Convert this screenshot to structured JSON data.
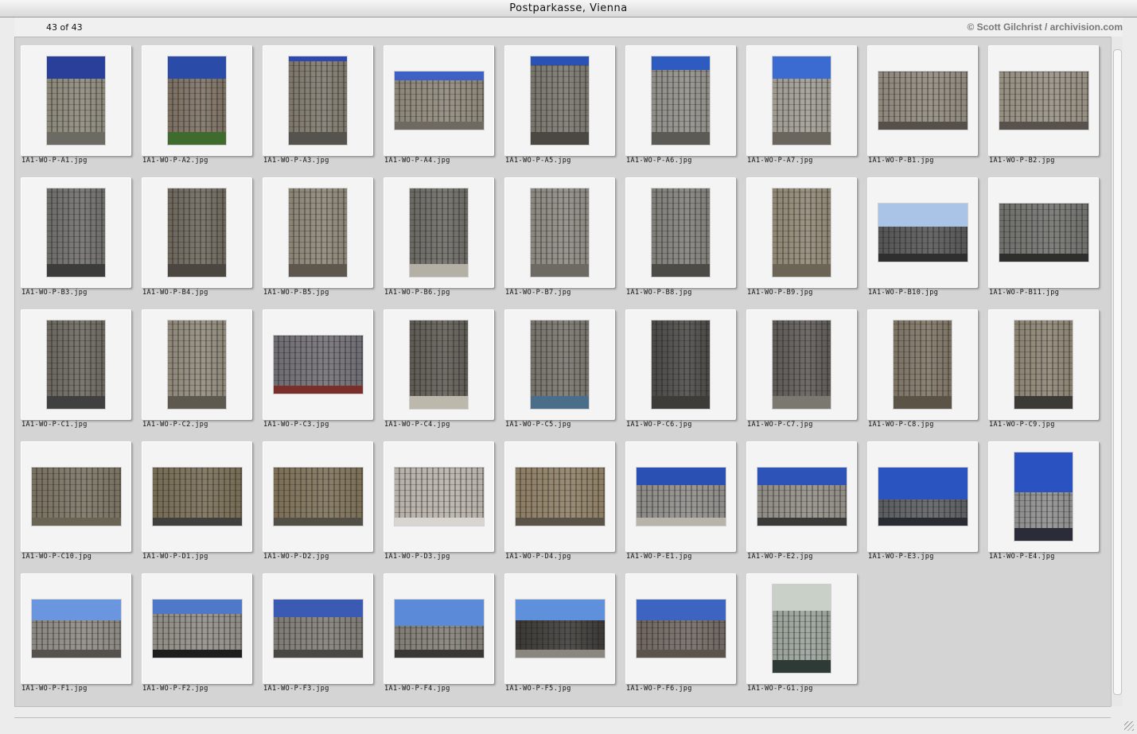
{
  "window": {
    "title": "Postparkasse, Vienna"
  },
  "info": {
    "count": "43 of 43",
    "copyright": "© Scott Gilchrist / archivision.com"
  },
  "thumbnails": [
    {
      "file": "1A1-WO-P-A1.jpg",
      "orient": "portrait",
      "sky": "#2a3f9a",
      "bldg": "#8a8678",
      "ground": "#6b6b63",
      "sky_frac": 0.25
    },
    {
      "file": "1A1-WO-P-A2.jpg",
      "orient": "portrait",
      "sky": "#2b4ba8",
      "bldg": "#7a6e60",
      "ground": "#3f6b2e",
      "sky_frac": 0.25
    },
    {
      "file": "1A1-WO-P-A3.jpg",
      "orient": "portrait",
      "sky": "#2d48b0",
      "bldg": "#7c766a",
      "ground": "#55534e",
      "sky_frac": 0.05
    },
    {
      "file": "1A1-WO-P-A4.jpg",
      "orient": "landscape",
      "sky": "#3f60c4",
      "bldg": "#8b8577",
      "ground": "#6e6a62",
      "sky_frac": 0.15
    },
    {
      "file": "1A1-WO-P-A5.jpg",
      "orient": "portrait",
      "sky": "#2a52b4",
      "bldg": "#77746c",
      "ground": "#4a4842",
      "sky_frac": 0.1
    },
    {
      "file": "1A1-WO-P-A6.jpg",
      "orient": "portrait",
      "sky": "#2d5bc0",
      "bldg": "#8e8c86",
      "ground": "#5c5a54",
      "sky_frac": 0.15
    },
    {
      "file": "1A1-WO-P-A7.jpg",
      "orient": "portrait",
      "sky": "#3b6ad0",
      "bldg": "#9e9a90",
      "ground": "#6a665e",
      "sky_frac": 0.25
    },
    {
      "file": "1A1-WO-P-B1.jpg",
      "orient": "landscape",
      "sky": "#b8b2a4",
      "bldg": "#8d867a",
      "ground": "#555049",
      "sky_frac": 0.0
    },
    {
      "file": "1A1-WO-P-B2.jpg",
      "orient": "landscape",
      "sky": "#c2bcae",
      "bldg": "#948d80",
      "ground": "#57524b",
      "sky_frac": 0.0
    },
    {
      "file": "1A1-WO-P-B3.jpg",
      "orient": "portrait",
      "sky": "#3d4f8f",
      "bldg": "#6c6b68",
      "ground": "#3c3c3a",
      "sky_frac": 0.0
    },
    {
      "file": "1A1-WO-P-B4.jpg",
      "orient": "portrait",
      "sky": "#aaa49a",
      "bldg": "#6b655a",
      "ground": "#4b4740",
      "sky_frac": 0.0
    },
    {
      "file": "1A1-WO-P-B5.jpg",
      "orient": "portrait",
      "sky": "#b9b2a4",
      "bldg": "#8a8374",
      "ground": "#5d574e",
      "sky_frac": 0.0
    },
    {
      "file": "1A1-WO-P-B6.jpg",
      "orient": "portrait",
      "sky": "#9e9c96",
      "bldg": "#6a6862",
      "ground": "#b4b0a6",
      "sky_frac": 0.0
    },
    {
      "file": "1A1-WO-P-B7.jpg",
      "orient": "portrait",
      "sky": "#54524c",
      "bldg": "#8a8780",
      "ground": "#6d6a64",
      "sky_frac": 0.0
    },
    {
      "file": "1A1-WO-P-B8.jpg",
      "orient": "portrait",
      "sky": "#c8cacc",
      "bldg": "#7f7d78",
      "ground": "#4d4b46",
      "sky_frac": 0.0
    },
    {
      "file": "1A1-WO-P-B9.jpg",
      "orient": "portrait",
      "sky": "#bbb39f",
      "bldg": "#8d8572",
      "ground": "#6c6555",
      "sky_frac": 0.0
    },
    {
      "file": "1A1-WO-P-B10.jpg",
      "orient": "landscape",
      "sky": "#a9c4e6",
      "bldg": "#545454",
      "ground": "#2f2f2f",
      "sky_frac": 0.4
    },
    {
      "file": "1A1-WO-P-B11.jpg",
      "orient": "landscape",
      "sky": "#a0a09a",
      "bldg": "#6e6e6a",
      "ground": "#2e2e2c",
      "sky_frac": 0.0
    },
    {
      "file": "1A1-WO-P-C1.jpg",
      "orient": "portrait",
      "sky": "#8f8a80",
      "bldg": "#6a665d",
      "ground": "#404040",
      "sky_frac": 0.0
    },
    {
      "file": "1A1-WO-P-C2.jpg",
      "orient": "portrait",
      "sky": "#b2ab9c",
      "bldg": "#8e8778",
      "ground": "#5e594f",
      "sky_frac": 0.0
    },
    {
      "file": "1A1-WO-P-C3.jpg",
      "orient": "landscape",
      "sky": "#3b3a3e",
      "bldg": "#6e6c72",
      "ground": "#7a2f2a",
      "sky_frac": 0.0
    },
    {
      "file": "1A1-WO-P-C4.jpg",
      "orient": "portrait",
      "sky": "#9f9c92",
      "bldg": "#5d5a53",
      "ground": "#bdb8ac",
      "sky_frac": 0.0
    },
    {
      "file": "1A1-WO-P-C5.jpg",
      "orient": "portrait",
      "sky": "#8a897f",
      "bldg": "#74726a",
      "ground": "#4a6d8a",
      "sky_frac": 0.0
    },
    {
      "file": "1A1-WO-P-C6.jpg",
      "orient": "portrait",
      "sky": "#5e5c58",
      "bldg": "#4a4845",
      "ground": "#3e3c39",
      "sky_frac": 0.0
    },
    {
      "file": "1A1-WO-P-C7.jpg",
      "orient": "portrait",
      "sky": "#444240",
      "bldg": "#5c5955",
      "ground": "#7b7870",
      "sky_frac": 0.0
    },
    {
      "file": "1A1-WO-P-C8.jpg",
      "orient": "portrait",
      "sky": "#9a9080",
      "bldg": "#7c7262",
      "ground": "#5b5346",
      "sky_frac": 0.0
    },
    {
      "file": "1A1-WO-P-C9.jpg",
      "orient": "portrait",
      "sky": "#aaa090",
      "bldg": "#8a8170",
      "ground": "#3c3a36",
      "sky_frac": 0.0
    },
    {
      "file": "1A1-WO-P-C10.jpg",
      "orient": "landscape",
      "sky": "#8a8478",
      "bldg": "#77705f",
      "ground": "#6a6454",
      "sky_frac": 0.0
    },
    {
      "file": "1A1-WO-P-D1.jpg",
      "orient": "landscape",
      "sky": "#8d7d5a",
      "bldg": "#756a52",
      "ground": "#40403e",
      "sky_frac": 0.0
    },
    {
      "file": "1A1-WO-P-D2.jpg",
      "orient": "landscape",
      "sky": "#8f7e58",
      "bldg": "#7b6e55",
      "ground": "#525046",
      "sky_frac": 0.0
    },
    {
      "file": "1A1-WO-P-D3.jpg",
      "orient": "landscape",
      "sky": "#3a3532",
      "bldg": "#b6b0a8",
      "ground": "#d8d4cf",
      "sky_frac": 0.0
    },
    {
      "file": "1A1-WO-P-D4.jpg",
      "orient": "landscape",
      "sky": "#30302e",
      "bldg": "#8c7c62",
      "ground": "#5a5348",
      "sky_frac": 0.0
    },
    {
      "file": "1A1-WO-P-E1.jpg",
      "orient": "landscape",
      "sky": "#2a50b4",
      "bldg": "#8c8a86",
      "ground": "#b8b4aa",
      "sky_frac": 0.3
    },
    {
      "file": "1A1-WO-P-E2.jpg",
      "orient": "landscape",
      "sky": "#2d53b8",
      "bldg": "#8f8b84",
      "ground": "#3a3a38",
      "sky_frac": 0.3
    },
    {
      "file": "1A1-WO-P-E3.jpg",
      "orient": "landscape",
      "sky": "#2a55c0",
      "bldg": "#5a5c60",
      "ground": "#2a2c34",
      "sky_frac": 0.55
    },
    {
      "file": "1A1-WO-P-E4.jpg",
      "orient": "portrait",
      "sky": "#2a52c0",
      "bldg": "#8c8c8c",
      "ground": "#2a2c38",
      "sky_frac": 0.45
    },
    {
      "file": "1A1-WO-P-F1.jpg",
      "orient": "landscape",
      "sky": "#6a96e0",
      "bldg": "#8a8680",
      "ground": "#55524e",
      "sky_frac": 0.35
    },
    {
      "file": "1A1-WO-P-F2.jpg",
      "orient": "landscape",
      "sky": "#5078c8",
      "bldg": "#8e8a84",
      "ground": "#1e1e1e",
      "sky_frac": 0.25
    },
    {
      "file": "1A1-WO-P-F3.jpg",
      "orient": "landscape",
      "sky": "#3a5ab4",
      "bldg": "#7d7a74",
      "ground": "#4a4844",
      "sky_frac": 0.3
    },
    {
      "file": "1A1-WO-P-F4.jpg",
      "orient": "landscape",
      "sky": "#5b8ad8",
      "bldg": "#807c74",
      "ground": "#3a3834",
      "sky_frac": 0.45
    },
    {
      "file": "1A1-WO-P-F5.jpg",
      "orient": "landscape",
      "sky": "#5f90dc",
      "bldg": "#3a3834",
      "ground": "#8a8680",
      "sky_frac": 0.35
    },
    {
      "file": "1A1-WO-P-F6.jpg",
      "orient": "landscape",
      "sky": "#3c64c0",
      "bldg": "#6e6560",
      "ground": "#5a544c",
      "sky_frac": 0.35
    },
    {
      "file": "1A1-WO-P-G1.jpg",
      "orient": "portrait",
      "sky": "#c8d0c8",
      "bldg": "#98a098",
      "ground": "#2e3a36",
      "sky_frac": 0.3
    }
  ]
}
